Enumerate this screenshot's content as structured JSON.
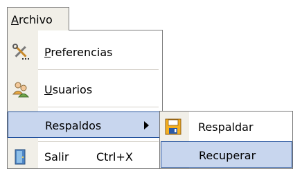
{
  "menubar": {
    "menu_title_first": "A",
    "menu_title_rest": "rchivo"
  },
  "main_menu": {
    "items": [
      {
        "label_first": "P",
        "label_rest": "referencias",
        "icon": "tools-icon"
      },
      {
        "label_first": "U",
        "label_rest": "suarios",
        "icon": "users-icon"
      },
      {
        "label": "Respaldos",
        "icon": "none",
        "has_submenu": true
      },
      {
        "label": "Salir",
        "shortcut": "Ctrl+X",
        "icon": "exit-door-icon"
      }
    ]
  },
  "submenu": {
    "items": [
      {
        "label": "Respaldar",
        "icon": "floppy-disk-icon"
      },
      {
        "label": "Recuperar",
        "icon": "none"
      }
    ]
  },
  "colors": {
    "highlight_fill": "#c8d6ee",
    "highlight_border": "#1f4f9c",
    "gutter": "#f1efe8"
  }
}
